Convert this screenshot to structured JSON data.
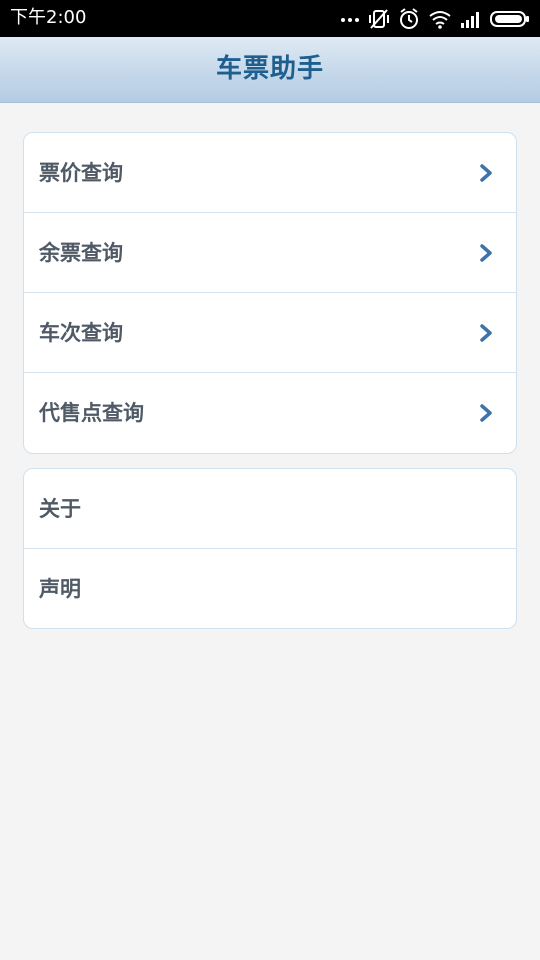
{
  "status_bar": {
    "time": "下午2:00",
    "icons": [
      "more-dots-icon",
      "vibrate-off-icon",
      "alarm-clock-icon",
      "wifi-icon",
      "signal-icon",
      "battery-icon"
    ]
  },
  "header": {
    "title": "车票助手"
  },
  "colors": {
    "header_title": "#1f5f8f",
    "label_text": "#4f5a66",
    "chevron": "#3f73a8",
    "background": "#f4f4f4"
  },
  "menu_main": {
    "items": [
      {
        "label": "票价查询",
        "icon": "chevron-right-icon"
      },
      {
        "label": "余票查询",
        "icon": "chevron-right-icon"
      },
      {
        "label": "车次查询",
        "icon": "chevron-right-icon"
      },
      {
        "label": "代售点查询",
        "icon": "chevron-right-icon"
      }
    ]
  },
  "menu_info": {
    "items": [
      {
        "label": "关于"
      },
      {
        "label": "声明"
      }
    ]
  }
}
